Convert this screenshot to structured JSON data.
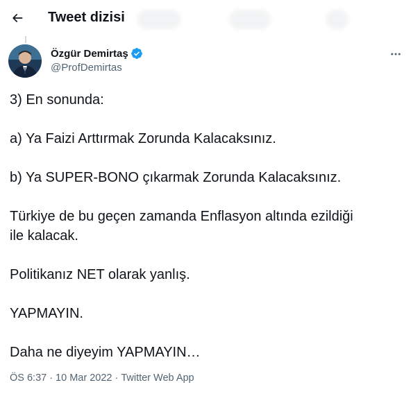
{
  "header": {
    "title": "Tweet dizisi",
    "back_icon": "arrow-left-icon"
  },
  "author": {
    "name": "Özgür Demirtaş",
    "handle": "@ProfDemirtas",
    "verified_icon": "verified-badge-icon",
    "verified_color": "#1d9bf0",
    "more_icon": "more-horizontal-icon"
  },
  "tweet": {
    "lines": [
      "3) En sonunda:",
      "a) Ya Faizi Arttırmak Zorunda Kalacaksınız.",
      "b) Ya SUPER-BONO çıkarmak Zorunda Kalacaksınız.",
      "Türkiye de bu geçen zamanda Enflasyon altında ezildiği",
      "ile kalacak.",
      "Politikanız NET olarak yanlış.",
      "YAPMAYIN.",
      "Daha ne diyeyim YAPMAYIN…"
    ]
  },
  "meta": {
    "time": "ÖS 6:37",
    "separator": "·",
    "date": "10 Mar 2022",
    "source": "Twitter Web App"
  },
  "colors": {
    "text": "#0f1419",
    "secondary": "#536471",
    "accent": "#1d9bf0",
    "thread_line": "#cfd9de"
  }
}
